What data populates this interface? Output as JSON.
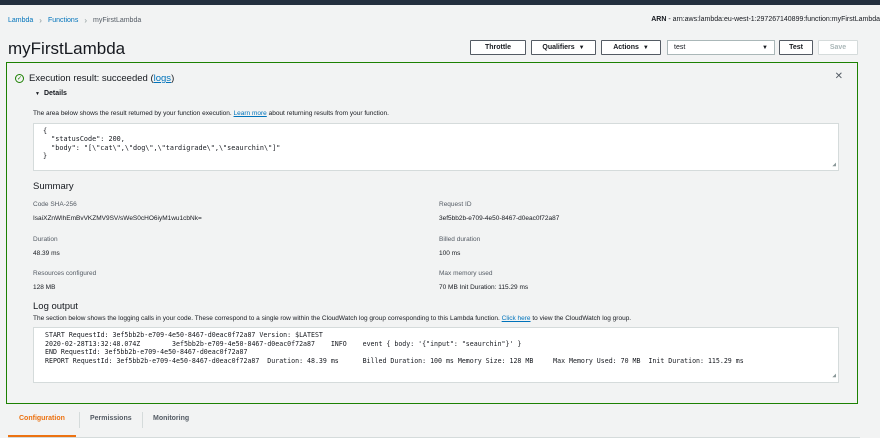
{
  "breadcrumb": {
    "lambda": "Lambda",
    "functions": "Functions",
    "current": "myFirstLambda"
  },
  "arn": {
    "label": "ARN",
    "value": "- arn:aws:lambda:eu-west-1:297267140899:function:myFirstLambda"
  },
  "page_title": "myFirstLambda",
  "toolbar": {
    "throttle": "Throttle",
    "qualifiers": "Qualifiers",
    "actions": "Actions",
    "test_event": "test",
    "test": "Test",
    "save": "Save"
  },
  "execution": {
    "status_prefix": "Execution result: succeeded (",
    "logs_link": "logs",
    "status_suffix": ")",
    "details_label": "Details",
    "description_prefix": "The area below shows the result returned by your function execution. ",
    "learn_more": "Learn more",
    "description_suffix": " about returning results from your function.",
    "result_text": "{\n  \"statusCode\": 200,\n  \"body\": \"[\\\"cat\\\",\\\"dog\\\",\\\"tardigrade\\\",\\\"seaurchin\\\"]\"\n}"
  },
  "summary": {
    "title": "Summary",
    "code_sha_label": "Code SHA-256",
    "code_sha_value": "IsaiXZnWlhEmBvVKZMV9SV/sWeS0cHO6iyM1wu1cbNk=",
    "request_id_label": "Request ID",
    "request_id_value": "3ef5bb2b-e709-4e50-8467-d0eac0f72a87",
    "duration_label": "Duration",
    "duration_value": "48.39 ms",
    "billed_label": "Billed duration",
    "billed_value": "100 ms",
    "resources_label": "Resources configured",
    "resources_value": "128 MB",
    "max_memory_label": "Max memory used",
    "max_memory_value": "70 MB Init Duration: 115.29 ms"
  },
  "log": {
    "title": "Log output",
    "desc_prefix": "The section below shows the logging calls in your code. These correspond to a single row within the CloudWatch log group corresponding to this Lambda function. ",
    "click_here": "Click here",
    "desc_suffix": " to view the CloudWatch log group.",
    "text": "START RequestId: 3ef5bb2b-e709-4e50-8467-d0eac0f72a87 Version: $LATEST\n2020-02-28T13:32:48.074Z\t3ef5bb2b-e709-4e50-8467-d0eac0f72a87\tINFO\tevent { body: '{\"input\": \"seaurchin\"}' }\nEND RequestId: 3ef5bb2b-e709-4e50-8467-d0eac0f72a87\nREPORT RequestId: 3ef5bb2b-e709-4e50-8467-d0eac0f72a87  Duration: 48.39 ms\tBilled Duration: 100 ms Memory Size: 128 MB\tMax Memory Used: 70 MB\tInit Duration: 115.29 ms"
  },
  "tabs": [
    "Configuration",
    "Permissions",
    "Monitoring"
  ],
  "colors": {
    "success": "#1d8102",
    "link": "#0073bb",
    "active_tab": "#ec7211",
    "topbar": "#232f3e"
  }
}
